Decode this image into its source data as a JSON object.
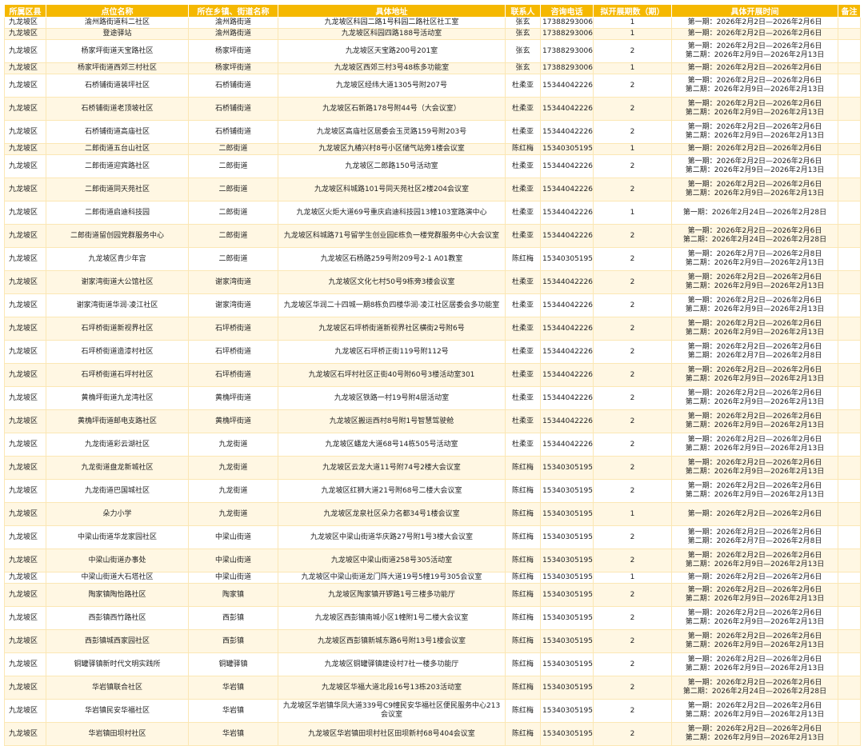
{
  "headers": [
    "所属区县",
    "点位名称",
    "所在乡镇、街道名称",
    "具体地址",
    "联系人",
    "咨询电话",
    "拟开展期数（期）",
    "具体开展时间",
    "备注"
  ],
  "rows": [
    {
      "district": "九龙坡区",
      "name": "渝州路街道科二社区",
      "street": "渝州路街道",
      "address": "九龙坡区科园二路1号科园二路社区社工室",
      "contact": "张玄",
      "phone": "17388293006",
      "count": "1",
      "periods": [
        "第一期：2026年2月2日—2026年2月6日"
      ]
    },
    {
      "district": "九龙坡区",
      "name": "登途驿站",
      "street": "渝州路街道",
      "address": "九龙坡区科园四路188号活动室",
      "contact": "张玄",
      "phone": "17388293006",
      "count": "1",
      "periods": [
        "第一期：2026年2月2日—2026年2月6日"
      ]
    },
    {
      "district": "九龙坡区",
      "name": "杨家坪街道天宝路社区",
      "street": "杨家坪街道",
      "address": "九龙坡区天宝路200号201室",
      "contact": "张玄",
      "phone": "17388293006",
      "count": "2",
      "periods": [
        "第一期：2026年2月2日—2026年2月6日",
        "第二期：2026年2月9日—2026年2月13日"
      ]
    },
    {
      "district": "九龙坡区",
      "name": "杨家坪街道西郊三村社区",
      "street": "杨家坪街道",
      "address": "九龙坡区西郊三村3号48栋多功能室",
      "contact": "张玄",
      "phone": "17388293006",
      "count": "1",
      "periods": [
        "第一期：2026年2月2日—2026年2月6日"
      ]
    },
    {
      "district": "九龙坡区",
      "name": "石桥铺街道装坪社区",
      "street": "石桥铺街道",
      "address": "九龙坡区经纬大道1305号附207号",
      "contact": "杜柔亚",
      "phone": "15344042226",
      "count": "2",
      "periods": [
        "第一期：2026年2月2日—2026年2月6日",
        "第二期：2026年2月9日—2026年2月13日"
      ]
    },
    {
      "district": "九龙坡区",
      "name": "石桥铺街道老顶坡社区",
      "street": "石桥铺街道",
      "address": "九龙坡区石新路178号附44号（大会议室）",
      "contact": "杜柔亚",
      "phone": "15344042226",
      "count": "2",
      "periods": [
        "第一期：2026年2月2日—2026年2月6日",
        "第二期：2026年2月9日—2026年2月13日"
      ]
    },
    {
      "district": "九龙坡区",
      "name": "石桥铺街道高庙社区",
      "street": "石桥铺街道",
      "address": "九龙坡区高庙社区居委会玉灵路159号附203号",
      "contact": "杜柔亚",
      "phone": "15344042226",
      "count": "2",
      "periods": [
        "第一期：2026年2月2日—2026年2月6日",
        "第二期：2026年2月9日—2026年2月13日"
      ]
    },
    {
      "district": "九龙坡区",
      "name": "二郎街道五台山社区",
      "street": "二郎街道",
      "address": "九龙坡区九椿兴村8号小区储气站旁1楼会议室",
      "contact": "陈红梅",
      "phone": "15340305195",
      "count": "1",
      "periods": [
        "第一期：2026年2月2日—2026年2月6日"
      ]
    },
    {
      "district": "九龙坡区",
      "name": "二郎街道迎宾路社区",
      "street": "二郎街道",
      "address": "九龙坡区二郎路150号活动室",
      "contact": "杜柔亚",
      "phone": "15344042226",
      "count": "2",
      "periods": [
        "第一期：2026年2月2日—2026年2月6日",
        "第二期：2026年2月9日—2026年2月13日"
      ]
    },
    {
      "district": "九龙坡区",
      "name": "二郎街道同天苑社区",
      "street": "二郎街道",
      "address": "九龙坡区科城路101号同天苑社区2楼204会议室",
      "contact": "杜柔亚",
      "phone": "15344042226",
      "count": "2",
      "periods": [
        "第一期：2026年2月2日—2026年2月6日",
        "第二期：2026年2月9日—2026年2月13日"
      ]
    },
    {
      "district": "九龙坡区",
      "name": "二郎街道启迪科技园",
      "street": "二郎街道",
      "address": "九龙坡区火炬大道69号重庆启迪科技园13幢103室路演中心",
      "contact": "杜柔亚",
      "phone": "15344042226",
      "count": "1",
      "periods": [
        "第一期：2026年2月24日—2026年2月28日"
      ]
    },
    {
      "district": "九龙坡区",
      "name": "二郎街道留创园党群服务中心",
      "street": "二郎街道",
      "address": "九龙坡区科城路71号留学生创业园E栋负一楼党群服务中心大会议室",
      "contact": "杜柔亚",
      "phone": "15344042226",
      "count": "2",
      "periods": [
        "第一期：2026年2月2日—2026年2月6日",
        "第二期：2026年2月24日—2026年2月28日"
      ]
    },
    {
      "district": "九龙坡区",
      "name": "九龙坡区青少年宫",
      "street": "二郎街道",
      "address": "九龙坡区石杨路259号附209号2-1 A01教室",
      "contact": "陈红梅",
      "phone": "15340305195",
      "count": "2",
      "periods": [
        "第一期：2026年2月7日—2026年2月8日",
        "第二期：2026年2月9日—2026年2月13日"
      ]
    },
    {
      "district": "九龙坡区",
      "name": "谢家湾街道大公馆社区",
      "street": "谢家湾街道",
      "address": "九龙坡区文化七村50号9栋旁3楼会议室",
      "contact": "杜柔亚",
      "phone": "15344042226",
      "count": "2",
      "periods": [
        "第一期：2026年2月2日—2026年2月6日",
        "第二期：2026年2月9日—2026年2月13日"
      ]
    },
    {
      "district": "九龙坡区",
      "name": "谢家湾街道华润·凌江社区",
      "street": "谢家湾街道",
      "address": "九龙坡区华润二十四城一期8栋负四楼华润·凌江社区居委会多功能室",
      "contact": "杜柔亚",
      "phone": "15344042226",
      "count": "2",
      "periods": [
        "第一期：2026年2月2日—2026年2月6日",
        "第二期：2026年2月9日—2026年2月13日"
      ]
    },
    {
      "district": "九龙坡区",
      "name": "石坪桥街道新视界社区",
      "street": "石坪桥街道",
      "address": "九龙坡区石坪桥街道新视界社区横街2号附6号",
      "contact": "杜柔亚",
      "phone": "15344042226",
      "count": "2",
      "periods": [
        "第一期：2026年2月2日—2026年2月6日",
        "第二期：2026年2月9日—2026年2月13日"
      ]
    },
    {
      "district": "九龙坡区",
      "name": "石坪桥街道造漆村社区",
      "street": "石坪桥街道",
      "address": "九龙坡区石坪桥正街119号附112号",
      "contact": "杜柔亚",
      "phone": "15344042226",
      "count": "2",
      "periods": [
        "第一期：2026年2月2日—2026年2月6日",
        "第二期：2026年2月7日—2026年2月8日"
      ]
    },
    {
      "district": "九龙坡区",
      "name": "石坪桥街道石坪村社区",
      "street": "石坪桥街道",
      "address": "九龙坡区石坪村社区正街40号附60号3楼活动室301",
      "contact": "杜柔亚",
      "phone": "15344042226",
      "count": "2",
      "periods": [
        "第一期：2026年2月2日—2026年2月6日",
        "第二期：2026年2月9日—2026年2月13日"
      ]
    },
    {
      "district": "九龙坡区",
      "name": "黄桷坪街道九龙湾社区",
      "street": "黄桷坪街道",
      "address": "九龙坡区铁路一村19号附4层活动室",
      "contact": "杜柔亚",
      "phone": "15344042226",
      "count": "2",
      "periods": [
        "第一期：2026年2月2日—2026年2月6日",
        "第二期：2026年2月9日—2026年2月13日"
      ]
    },
    {
      "district": "九龙坡区",
      "name": "黄桷坪街道邮电支路社区",
      "street": "黄桷坪街道",
      "address": "九龙坡区搬运西村8号附1号智慧驾驶舱",
      "contact": "杜柔亚",
      "phone": "15344042226",
      "count": "2",
      "periods": [
        "第一期：2026年2月2日—2026年2月6日",
        "第二期：2026年2月9日—2026年2月13日"
      ]
    },
    {
      "district": "九龙坡区",
      "name": "九龙街道彩云湖社区",
      "street": "九龙街道",
      "address": "九龙坡区蟠龙大道68号14栋505号活动室",
      "contact": "杜柔亚",
      "phone": "15344042226",
      "count": "2",
      "periods": [
        "第一期：2026年2月2日—2026年2月6日",
        "第二期：2026年2月9日—2026年2月13日"
      ]
    },
    {
      "district": "九龙坡区",
      "name": "九龙街道盘龙新城社区",
      "street": "九龙街道",
      "address": "九龙坡区云龙大道11号附74号2楼大会议室",
      "contact": "陈红梅",
      "phone": "15340305195",
      "count": "2",
      "periods": [
        "第一期：2026年2月2日—2026年2月6日",
        "第二期：2026年2月9日—2026年2月13日"
      ]
    },
    {
      "district": "九龙坡区",
      "name": "九龙街道巴国城社区",
      "street": "九龙街道",
      "address": "九龙坡区红狮大道21号附68号二楼大会议室",
      "contact": "陈红梅",
      "phone": "15340305195",
      "count": "2",
      "periods": [
        "第一期：2026年2月2日—2026年2月6日",
        "第二期：2026年2月9日—2026年2月13日"
      ]
    },
    {
      "district": "九龙坡区",
      "name": "朵力小学",
      "street": "九龙街道",
      "address": "九龙坡区龙泉社区朵力名都34号1楼会议室",
      "contact": "陈红梅",
      "phone": "15340305195",
      "count": "1",
      "periods": [
        "第一期：2026年2月2日—2026年2月6日"
      ]
    },
    {
      "district": "九龙坡区",
      "name": "中梁山街道华龙家园社区",
      "street": "中梁山街道",
      "address": "九龙坡区中梁山街道华庆路27号附1号3楼大会议室",
      "contact": "陈红梅",
      "phone": "15340305195",
      "count": "2",
      "periods": [
        "第一期：2026年2月2日—2026年2月6日",
        "第二期：2026年2月7日—2026年2月8日"
      ]
    },
    {
      "district": "九龙坡区",
      "name": "中梁山街道办事处",
      "street": "中梁山街道",
      "address": "九龙坡区中梁山街道258号305活动室",
      "contact": "陈红梅",
      "phone": "15340305195",
      "count": "2",
      "periods": [
        "第一期：2026年2月2日—2026年2月6日",
        "第二期：2026年2月9日—2026年2月13日"
      ]
    },
    {
      "district": "九龙坡区",
      "name": "中梁山街道大石塔社区",
      "street": "中梁山街道",
      "address": "九龙坡区中梁山街道龙门阵大道19号5幢19号305会议室",
      "contact": "陈红梅",
      "phone": "15340305195",
      "count": "1",
      "periods": [
        "第一期：2026年2月2日—2026年2月6日"
      ]
    },
    {
      "district": "九龙坡区",
      "name": "陶家镇陶怡路社区",
      "street": "陶家镇",
      "address": "九龙坡区陶家镇开锣路1号三楼多功能厅",
      "contact": "陈红梅",
      "phone": "15340305195",
      "count": "2",
      "periods": [
        "第一期：2026年2月2日—2026年2月6日",
        "第二期：2026年2月9日—2026年2月13日"
      ]
    },
    {
      "district": "九龙坡区",
      "name": "西彭镇西竹路社区",
      "street": "西彭镇",
      "address": "九龙坡区西彭镇南城小区1幢附1号二楼大会议室",
      "contact": "陈红梅",
      "phone": "15340305195",
      "count": "2",
      "periods": [
        "第一期：2026年2月2日—2026年2月6日",
        "第二期：2026年2月9日—2026年2月13日"
      ]
    },
    {
      "district": "九龙坡区",
      "name": "西彭镇城西家园社区",
      "street": "西彭镇",
      "address": "九龙坡区西彭镇新城东路6号附13号1楼会议室",
      "contact": "陈红梅",
      "phone": "15340305195",
      "count": "2",
      "periods": [
        "第一期：2026年2月2日—2026年2月6日",
        "第二期：2026年2月9日—2026年2月13日"
      ]
    },
    {
      "district": "九龙坡区",
      "name": "铜罐驿镇新时代文明实践所",
      "street": "铜罐驿镇",
      "address": "九龙坡区铜罐驿镇建设村7社一楼多功能厅",
      "contact": "陈红梅",
      "phone": "15340305195",
      "count": "2",
      "periods": [
        "第一期：2026年2月2日—2026年2月6日",
        "第二期：2026年2月9日—2026年2月13日"
      ]
    },
    {
      "district": "九龙坡区",
      "name": "华岩镇联合社区",
      "street": "华岩镇",
      "address": "九龙坡区华福大道北段16号13栋203活动室",
      "contact": "陈红梅",
      "phone": "15340305195",
      "count": "2",
      "periods": [
        "第一期：2026年2月2日—2026年2月6日",
        "第二期：2026年2月24日—2026年2月28日"
      ]
    },
    {
      "district": "九龙坡区",
      "name": "华岩镇民安华福社区",
      "street": "华岩镇",
      "address": "九龙坡区华岩镇华凤大道339号C9幢民安华福社区便民服务中心213会议室",
      "contact": "陈红梅",
      "phone": "15340305195",
      "count": "2",
      "periods": [
        "第一期：2026年2月2日—2026年2月6日",
        "第二期：2026年2月9日—2026年2月13日"
      ]
    },
    {
      "district": "九龙坡区",
      "name": "华岩镇田坝村社区",
      "street": "华岩镇",
      "address": "九龙坡区华岩镇田坝村社区田坝新村68号404会议室",
      "contact": "陈红梅",
      "phone": "15340305195",
      "count": "2",
      "periods": [
        "第一期：2026年2月2日—2026年2月6日",
        "第二期：2026年2月9日—2026年2月13日"
      ]
    }
  ]
}
